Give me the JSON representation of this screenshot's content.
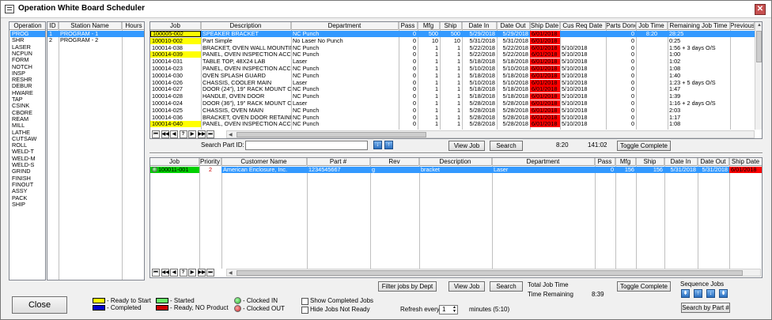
{
  "window": {
    "title": "Operation White Board Scheduler",
    "close_glyph": "✕"
  },
  "colors": {
    "yellow": "#ffff00",
    "red": "#ff0000",
    "green": "#00d000",
    "blue": "#0000cc",
    "selection": "#3399ff",
    "dark_red": "#cc0000"
  },
  "operations": {
    "header": "Operation",
    "items": [
      "PROG",
      "SHR",
      "LASER",
      "NCPUN",
      "FORM",
      "NOTCH",
      "INSP",
      "RESHR",
      "DEBUR",
      "HWARE",
      "TAP",
      "CSINK",
      "CBORE",
      "REAM",
      "MILL",
      "LATHE",
      "CUTSAW",
      "ROLL",
      "WELD-T",
      "WELD-M",
      "WELD-S",
      "GRIND",
      "FINISH",
      "FINOUT",
      "ASSY",
      "PACK",
      "SHIP"
    ],
    "selected": 0
  },
  "stations": {
    "headers": [
      "ID",
      "Station Name",
      "Hours"
    ],
    "rows": [
      {
        "id": "1",
        "name": "PROGRAM - 1",
        "hours": ""
      },
      {
        "id": "2",
        "name": "PROGRAM - 2",
        "hours": ""
      }
    ]
  },
  "top_grid": {
    "headers": [
      "Job",
      "Description",
      "Department",
      "Pass",
      "Mfg",
      "Ship",
      "Date In",
      "Date Out",
      "Ship Date",
      "Cus Req Date",
      "Parts Done",
      "Job Time",
      "Remaining Job Time",
      "Previous"
    ],
    "rows": [
      {
        "job": "100005-002",
        "desc": "SPEAKER BRACKET",
        "dept": "NC Punch",
        "pass": "0",
        "mfg": "500",
        "ship": "500",
        "date_in": "5/29/2018",
        "date_out": "5/29/2018",
        "ship_date": "6/01/2018",
        "cus_req": "",
        "parts_done": "0",
        "job_time": "8:20",
        "remaining": "28:25",
        "previous": "",
        "job_color": "yellow",
        "ship_red": true,
        "selected": true
      },
      {
        "job": "100010-002",
        "desc": "Part Simple",
        "dept": "No Laser No Punch",
        "pass": "0",
        "mfg": "10",
        "ship": "10",
        "date_in": "5/31/2018",
        "date_out": "5/31/2018",
        "ship_date": "6/01/2018",
        "cus_req": "",
        "parts_done": "0",
        "job_time": "",
        "remaining": "0:25",
        "previous": "",
        "job_color": "yellow",
        "ship_red": true,
        "selected": false
      },
      {
        "job": "100014-038",
        "desc": "BRACKET, OVEN WALL MOUNTIN",
        "dept": "NC Punch",
        "pass": "0",
        "mfg": "1",
        "ship": "1",
        "date_in": "5/22/2018",
        "date_out": "5/22/2018",
        "ship_date": "6/01/2018",
        "cus_req": "5/10/2018",
        "parts_done": "0",
        "job_time": "",
        "remaining": "1:56 + 3 days O/S",
        "previous": "",
        "job_color": "",
        "ship_red": true,
        "selected": false
      },
      {
        "job": "100014-039",
        "desc": "PANEL, OVEN INSPECTION ACC",
        "dept": "NC Punch",
        "pass": "0",
        "mfg": "1",
        "ship": "1",
        "date_in": "5/22/2018",
        "date_out": "5/22/2018",
        "ship_date": "6/01/2018",
        "cus_req": "5/10/2018",
        "parts_done": "0",
        "job_time": "",
        "remaining": "1:00",
        "previous": "",
        "job_color": "yellow",
        "ship_red": true,
        "selected": false
      },
      {
        "job": "100014-031",
        "desc": "TABLE TOP, 48X24 LAB",
        "dept": "Laser",
        "pass": "0",
        "mfg": "1",
        "ship": "1",
        "date_in": "5/18/2018",
        "date_out": "5/18/2018",
        "ship_date": "6/01/2018",
        "cus_req": "5/10/2018",
        "parts_done": "0",
        "job_time": "",
        "remaining": "1:02",
        "previous": "",
        "job_color": "",
        "ship_red": true,
        "selected": false
      },
      {
        "job": "100014-023",
        "desc": "PANEL, OVEN INSPECTION ACCE",
        "dept": "NC Punch",
        "pass": "0",
        "mfg": "1",
        "ship": "1",
        "date_in": "5/10/2018",
        "date_out": "5/10/2018",
        "ship_date": "6/01/2018",
        "cus_req": "5/10/2018",
        "parts_done": "0",
        "job_time": "",
        "remaining": "1:08",
        "previous": "",
        "job_color": "",
        "ship_red": true,
        "selected": false
      },
      {
        "job": "100014-030",
        "desc": "OVEN SPLASH GUARD",
        "dept": "NC Punch",
        "pass": "0",
        "mfg": "1",
        "ship": "1",
        "date_in": "5/18/2018",
        "date_out": "5/18/2018",
        "ship_date": "6/01/2018",
        "cus_req": "5/10/2018",
        "parts_done": "0",
        "job_time": "",
        "remaining": "1:40",
        "previous": "",
        "job_color": "",
        "ship_red": true,
        "selected": false
      },
      {
        "job": "100014-026",
        "desc": "CHASSIS, COOLER MAIN",
        "dept": "Laser",
        "pass": "0",
        "mfg": "1",
        "ship": "1",
        "date_in": "5/10/2018",
        "date_out": "5/10/2018",
        "ship_date": "6/01/2018",
        "cus_req": "5/10/2018",
        "parts_done": "0",
        "job_time": "",
        "remaining": "1:23 + 5 days O/S",
        "previous": "",
        "job_color": "",
        "ship_red": true,
        "selected": false
      },
      {
        "job": "100014-027",
        "desc": "DOOR (24\"), 19\" RACK MOUNT C",
        "dept": "NC Punch",
        "pass": "0",
        "mfg": "1",
        "ship": "1",
        "date_in": "5/18/2018",
        "date_out": "5/18/2018",
        "ship_date": "6/01/2018",
        "cus_req": "5/10/2018",
        "parts_done": "0",
        "job_time": "",
        "remaining": "1:47",
        "previous": "",
        "job_color": "",
        "ship_red": true,
        "selected": false
      },
      {
        "job": "100014-028",
        "desc": "HANDLE, OVEN DOOR",
        "dept": "NC Punch",
        "pass": "0",
        "mfg": "1",
        "ship": "1",
        "date_in": "5/18/2018",
        "date_out": "5/18/2018",
        "ship_date": "6/01/2018",
        "cus_req": "5/10/2018",
        "parts_done": "0",
        "job_time": "",
        "remaining": "1:39",
        "previous": "",
        "job_color": "",
        "ship_red": true,
        "selected": false
      },
      {
        "job": "100014-024",
        "desc": "DOOR (36\"), 19\" RACK MOUNT C",
        "dept": "Laser",
        "pass": "0",
        "mfg": "1",
        "ship": "1",
        "date_in": "5/28/2018",
        "date_out": "5/28/2018",
        "ship_date": "6/01/2018",
        "cus_req": "5/10/2018",
        "parts_done": "0",
        "job_time": "",
        "remaining": "1:16 + 2 days O/S",
        "previous": "",
        "job_color": "",
        "ship_red": true,
        "selected": false
      },
      {
        "job": "100014-025",
        "desc": "CHASSIS, OVEN MAIN",
        "dept": "NC Punch",
        "pass": "0",
        "mfg": "1",
        "ship": "1",
        "date_in": "5/28/2018",
        "date_out": "5/28/2018",
        "ship_date": "6/01/2018",
        "cus_req": "5/10/2018",
        "parts_done": "0",
        "job_time": "",
        "remaining": "2:03",
        "previous": "",
        "job_color": "",
        "ship_red": true,
        "selected": false
      },
      {
        "job": "100014-036",
        "desc": "BRACKET, OVEN DOOR RETAINE",
        "dept": "NC Punch",
        "pass": "0",
        "mfg": "1",
        "ship": "1",
        "date_in": "5/28/2018",
        "date_out": "5/28/2018",
        "ship_date": "6/01/2018",
        "cus_req": "5/10/2018",
        "parts_done": "0",
        "job_time": "",
        "remaining": "1:17",
        "previous": "",
        "job_color": "",
        "ship_red": true,
        "selected": false
      },
      {
        "job": "100014-040",
        "desc": "PANEL, OVEN INSPECTION ACCE",
        "dept": "NC Punch",
        "pass": "0",
        "mfg": "1",
        "ship": "1",
        "date_in": "5/28/2018",
        "date_out": "5/28/2018",
        "ship_date": "6/01/2018",
        "cus_req": "5/10/2018",
        "parts_done": "0",
        "job_time": "",
        "remaining": "1:08",
        "previous": "",
        "job_color": "yellow",
        "ship_red": true,
        "selected": false
      }
    ]
  },
  "nav_buttons": [
    "⏮",
    "◀◀",
    "◀",
    "?",
    "▶",
    "▶▶",
    "⏭"
  ],
  "search": {
    "label": "Search Part ID:",
    "value": "",
    "view_job": "View Job",
    "search": "Search",
    "time1": "8:20",
    "time2": "141:02",
    "toggle": "Toggle Complete"
  },
  "bottom_grid": {
    "headers": [
      "Job",
      "Priority",
      "Customer Name",
      "Part #",
      "Rev",
      "Description",
      "Department",
      "Pass",
      "Mfg",
      "Ship",
      "Date In",
      "Date Out",
      "Ship Date"
    ],
    "rows": [
      {
        "job": "100011-001",
        "priority": "2",
        "customer": "American Enclosure, Inc.",
        "part": "1234545667",
        "rev": "g",
        "desc": "bracket",
        "dept": "Laser",
        "pass": "0",
        "mfg": "156",
        "ship": "156",
        "date_in": "5/31/2018",
        "date_out": "5/31/2018",
        "ship_date": "6/01/2018"
      }
    ]
  },
  "bottom_controls": {
    "filter": "Filter jobs by Dept",
    "view_job": "View Job",
    "search": "Search",
    "total_job_time_label": "Total Job Time",
    "time_remaining_label": "Time Remaining",
    "time_remaining": "8:39",
    "toggle": "Toggle Complete",
    "sequence_label": "Sequence Jobs",
    "seq_buttons": [
      "⇞",
      "↑",
      "↓",
      "⇟"
    ],
    "search_by_part": "Search by Part #",
    "close": "Close",
    "legend": {
      "ready_to_start": "- Ready to Start",
      "completed": "- Completed",
      "started": "- Started",
      "ready_no_product": "- Ready, NO Product",
      "clocked_in": "- Clocked IN",
      "clocked_out": "- Clocked OUT"
    },
    "show_completed": "Show Completed Jobs",
    "hide_not_ready": "Hide Jobs Not Ready",
    "refresh_label": "Refresh every",
    "refresh_value": "1",
    "refresh_suffix": "minutes (5:10)"
  }
}
